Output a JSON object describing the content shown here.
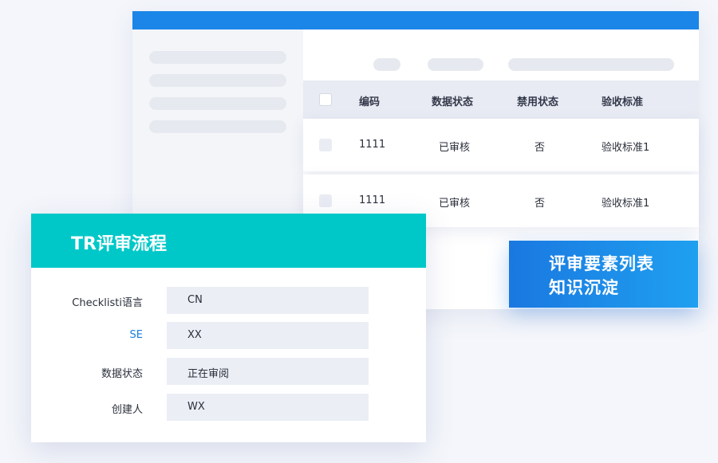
{
  "table": {
    "headers": [
      "编码",
      "数据状态",
      "禁用状态",
      "验收标准"
    ],
    "rows": [
      [
        "1111",
        "已审核",
        "否",
        "验收标准1"
      ],
      [
        "1111",
        "已审核",
        "否",
        "验收标准1"
      ]
    ]
  },
  "banner": {
    "line1": "评审要素列表",
    "line2": "知识沉淀"
  },
  "tr_card": {
    "title": "TR评审流程",
    "fields": [
      {
        "label": "Checklisti语言",
        "value": "CN"
      },
      {
        "label": "SE",
        "value": "XX"
      },
      {
        "label": "数据状态",
        "value": "正在审阅"
      },
      {
        "label": "创建人",
        "value": "WX"
      }
    ]
  },
  "colors": {
    "topbar": "#1b86e8",
    "tr_header": "#00c8c8",
    "banner_start": "#1a78e0",
    "banner_end": "#1fa0f0",
    "link": "#1a7fe0"
  }
}
